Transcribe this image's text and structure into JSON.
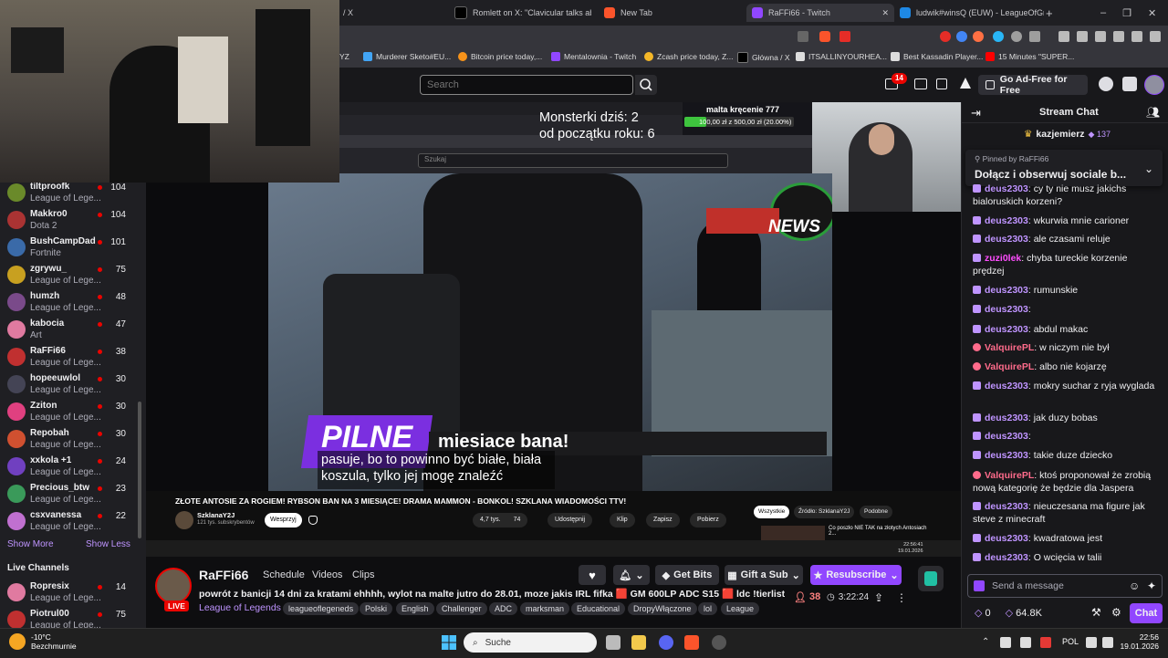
{
  "colors": {
    "twitch_purple": "#9147ff",
    "live_red": "#eb0400",
    "chat_user": "#bf94ff",
    "valquire": "#ff6b8b",
    "zuzi": "#ff4dff"
  },
  "browser": {
    "tabs": [
      {
        "label": "/ X",
        "icon": "x-icon"
      },
      {
        "label": "Romlett on X: \"Clavicular talks about\"",
        "icon": "x-icon"
      },
      {
        "label": "New Tab",
        "icon": "brave-icon"
      },
      {
        "label": "RaFFi66 - Twitch",
        "icon": "twitch-icon"
      },
      {
        "label": "ludwik#winsQ (EUW) - LeagueOfGra",
        "icon": "lolgraphs-icon"
      }
    ],
    "bookmarks": [
      {
        "label": "YZ"
      },
      {
        "label": "Murderer Sketo#EU..."
      },
      {
        "label": "Bitcoin price today,..."
      },
      {
        "label": "Mentalownia - Twitch"
      },
      {
        "label": "Zcash price today, Z..."
      },
      {
        "label": "Główna / X"
      },
      {
        "label": "ITSALLINYOURHEA..."
      },
      {
        "label": "Best Kassadin Player..."
      },
      {
        "label": "15 Minutes \"SUPER..."
      }
    ]
  },
  "topnav": {
    "search_placeholder": "Search",
    "notif_count": "14",
    "ad_free_label": "Go Ad-Free for Free"
  },
  "sidebar": {
    "channels": [
      {
        "name": "tiltproofk",
        "game": "League of Lege...",
        "viewers": "104"
      },
      {
        "name": "Makkro0",
        "game": "Dota 2",
        "viewers": "104"
      },
      {
        "name": "BushCampDad",
        "game": "Fortnite",
        "viewers": "101"
      },
      {
        "name": "zgrywu_",
        "game": "League of Lege...",
        "viewers": "75"
      },
      {
        "name": "humzh",
        "game": "League of Lege...",
        "viewers": "48"
      },
      {
        "name": "kabocia",
        "game": "Art",
        "viewers": "47"
      },
      {
        "name": "RaFFi66",
        "game": "League of Lege...",
        "viewers": "38"
      },
      {
        "name": "hopeeuwlol",
        "game": "League of Lege...",
        "viewers": "30"
      },
      {
        "name": "Zziton",
        "game": "League of Lege...",
        "viewers": "30"
      },
      {
        "name": "Repobah",
        "game": "League of Lege...",
        "viewers": "30"
      },
      {
        "name": "xxkola +1",
        "game": "League of Lege...",
        "viewers": "24"
      },
      {
        "name": "Precious_btw",
        "game": "League of Lege...",
        "viewers": "23"
      },
      {
        "name": "csxvanessa",
        "game": "League of Lege...",
        "viewers": "22"
      }
    ],
    "show_more": "Show More",
    "show_less": "Show Less",
    "live_channels_title": "Live Channels",
    "live_channels": [
      {
        "name": "Ropresix",
        "game": "League of Lege...",
        "viewers": "14"
      },
      {
        "name": "Piotrul00",
        "game": "League of Lege...",
        "viewers": "75"
      }
    ]
  },
  "video": {
    "overlay_line1": "Monsterki dziś: 2",
    "overlay_line2": "od początku roku: 6",
    "stream_goal_title": "malta kręcenie 777",
    "stream_goal_value": "100,00 zł z 500,00 zł (20.00%)",
    "stream_goal_progress": 20,
    "inner_search": "Szukaj",
    "news_logo": "NEWS",
    "pilne_label": "PILNE",
    "headline": "miesiace bana!",
    "subtitle_line1": "pasuje, bo to powinno być białe, biała",
    "subtitle_line2": "koszula, tylko jej mogę znaleźć",
    "yt": {
      "title": "ZŁOTE ANTOSIE ZA ROGIEM! RYBSON BAN NA 3 MIESIĄCE! DRAMA MAMMON - BONKOL! SZKLANA WIADOMOŚCI TTV!",
      "channel": "SzklanaY2J",
      "subs": "121 tys. subskrybentów",
      "support": "Wesprzyj",
      "likes": "4,7 tys.",
      "comments": "74",
      "share": "Udostępnij",
      "clip": "Klip",
      "save": "Zapisz",
      "download": "Pobierz",
      "filter_all": "Wszystkie",
      "filter_source": "Źródło: SzklanaY2J",
      "filter_similar": "Podobne",
      "related_title": "Co poszło NIE TAK na złotych Antosiach 2...",
      "time": "22:56:41",
      "date": "19.01.2026"
    }
  },
  "stream_info": {
    "streamer": "RaFFi66",
    "nav": [
      "Schedule",
      "Videos",
      "Clips"
    ],
    "title": "powrót z banicji 14 dni za kratami ehhhh, wylot na malte jutro do 28.01, moze jakis IRL fifka 🟥 GM 600LP ADC S15 🟥 ldc !tierlist",
    "game": "League of Legends",
    "live_badge": "LIVE",
    "tags": [
      "leagueoflegeneds",
      "Polski",
      "English",
      "Challenger",
      "ADC",
      "marksman",
      "Educational",
      "DropyWłączone",
      "lol",
      "League"
    ],
    "viewers": "38",
    "uptime": "3:22:24",
    "get_bits": "Get Bits",
    "gift_sub": "Gift a Sub",
    "resubscribe": "Resubscribe"
  },
  "chat": {
    "title": "Stream Chat",
    "top_gifter": "kazjemierz",
    "top_gifter_count": "137",
    "pinned_by_label": "Pinned by",
    "pinned_by": "RaFFi66",
    "pinned_text": "Dołącz i obserwuj sociale b...",
    "messages": [
      {
        "user": "deus2303",
        "text": ": cy ty nie musz jakichs bialoruskich korzeni?",
        "kind": "sub"
      },
      {
        "user": "deus2303",
        "text": ": wkurwia mnie carioner",
        "kind": "sub"
      },
      {
        "user": "deus2303",
        "text": ": ale czasami reluje",
        "kind": "sub"
      },
      {
        "user": "zuzi0lek",
        "text": ": chyba tureckie korzenie prędzej",
        "kind": "zuzi"
      },
      {
        "user": "deus2303",
        "text": ": rumunskie",
        "kind": "sub"
      },
      {
        "user": "deus2303",
        "text": ":",
        "kind": "sub"
      },
      {
        "user": "deus2303",
        "text": ": abdul makac",
        "kind": "sub"
      },
      {
        "user": "ValquirePL",
        "text": ": w niczym nie był",
        "kind": "heart"
      },
      {
        "user": "ValquirePL",
        "text": ": albo nie kojarzę",
        "kind": "heart"
      },
      {
        "user": "deus2303",
        "text": ": mokry suchar z ryja wygladа",
        "kind": "sub"
      },
      {
        "user": "deus2303",
        "text": ": jak duzy bobas",
        "kind": "sub"
      },
      {
        "user": "deus2303",
        "text": ":",
        "kind": "sub"
      },
      {
        "user": "deus2303",
        "text": ": takie duze dziecko",
        "kind": "sub"
      },
      {
        "user": "ValquirePL",
        "text": ": ktoś proponował że zrobią nową kategorię że będzie dla Jaspera",
        "kind": "heart"
      },
      {
        "user": "deus2303",
        "text": ": nieuczesana ma figure jak steve z minecraft",
        "kind": "sub"
      },
      {
        "user": "deus2303",
        "text": ": kwadratowa jest",
        "kind": "sub"
      },
      {
        "user": "deus2303",
        "text": ": O wcięcia w talii",
        "kind": "sub"
      }
    ],
    "input_placeholder": "Send a message",
    "points": "0",
    "bits": "64.8K",
    "chat_button": "Chat"
  },
  "taskbar": {
    "weather_temp": "-10°C",
    "weather_desc": "Bezchmurnie",
    "search": "Suche",
    "lang": "POL",
    "time": "22:56",
    "date": "19.01.2026"
  }
}
